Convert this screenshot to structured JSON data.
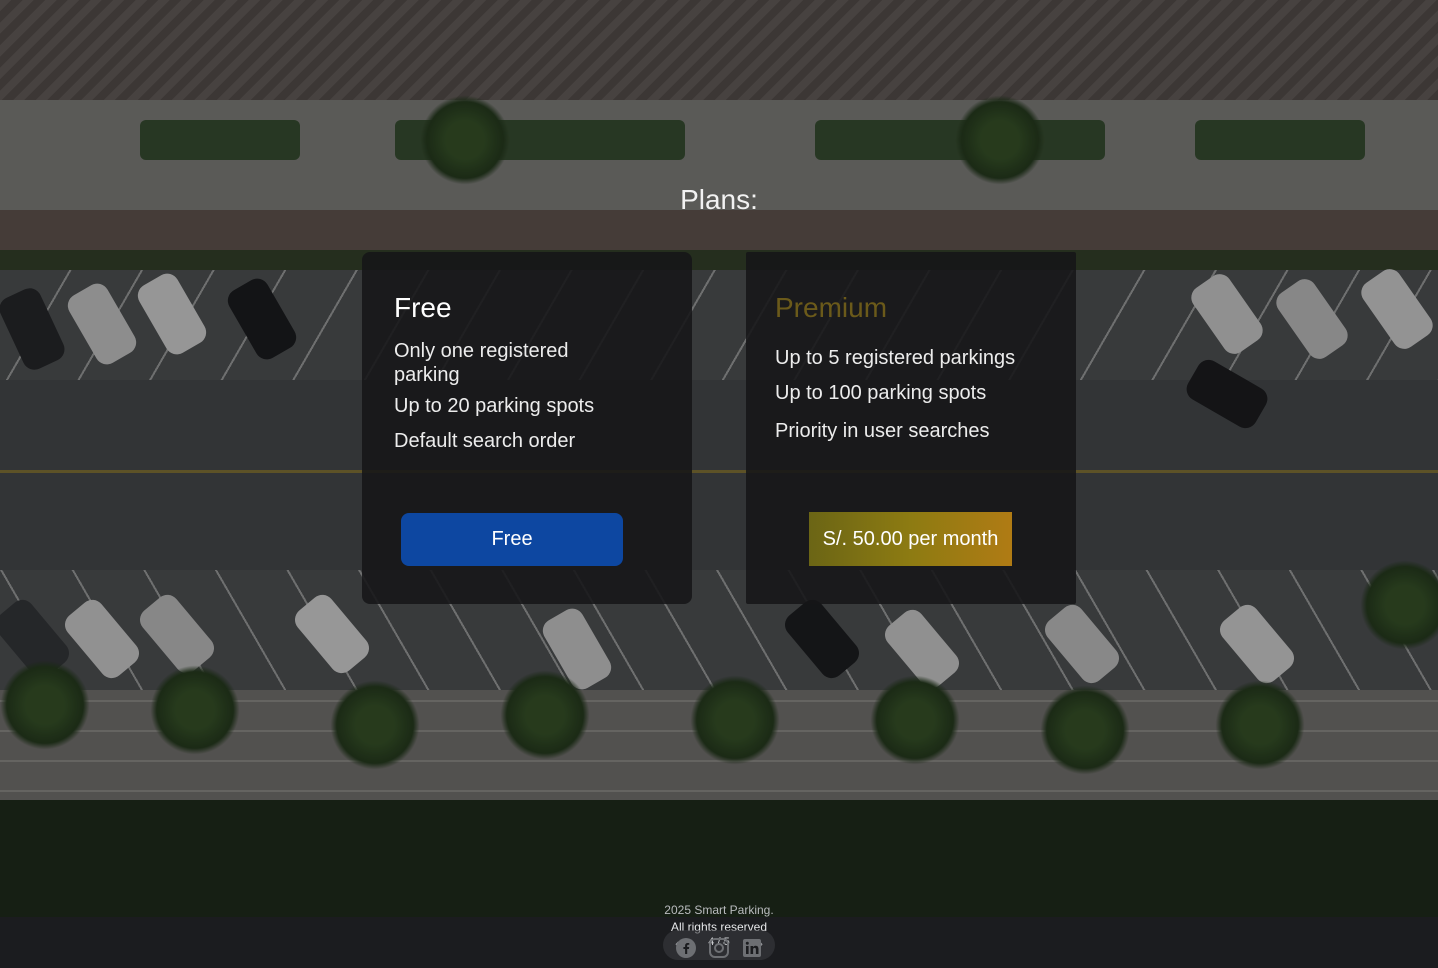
{
  "page": {
    "title": "Plans:"
  },
  "plans": [
    {
      "name": "Free",
      "features": [
        "Only one registered parking",
        "Up to 20 parking spots",
        "Default search order"
      ],
      "button": "Free"
    },
    {
      "name": "Premium",
      "features": [
        "Up to 5 registered parkings",
        "Up to 100 parking spots",
        "Priority in user searches"
      ],
      "button": "S/. 50.00 per month"
    }
  ],
  "footer": {
    "copyright_line1": "2025 Smart Parking.",
    "copyright_line2": "All rights reserved",
    "pager": "4 / 5",
    "social_icons": [
      "facebook-icon",
      "instagram-icon",
      "linkedin-icon"
    ]
  },
  "colors": {
    "free_button": "#0d47a1",
    "premium_title": "#6b5a1a",
    "premium_button_start": "#6b6515",
    "premium_button_end": "#b07b14"
  }
}
